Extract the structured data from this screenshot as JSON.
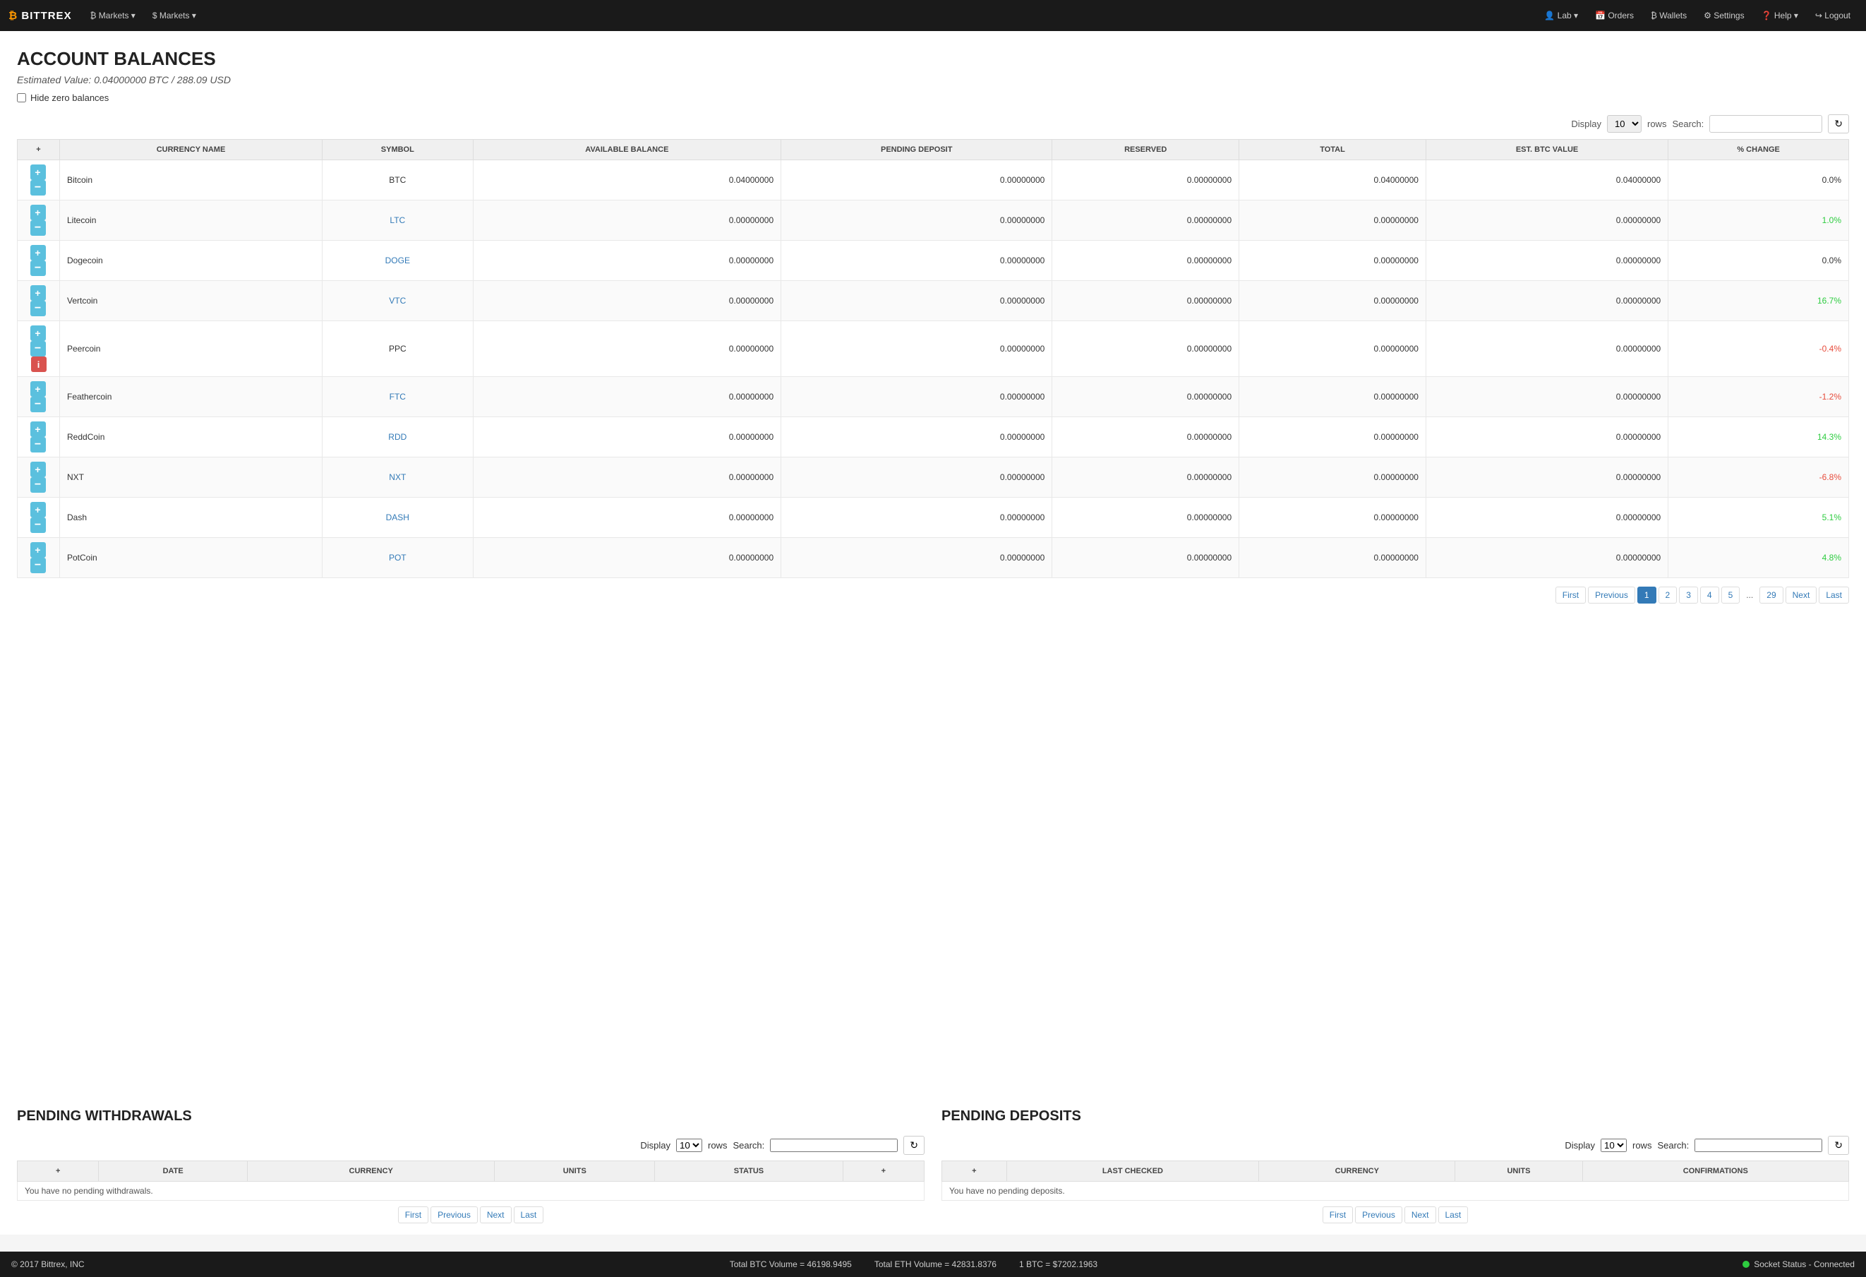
{
  "nav": {
    "logo": "BITTREX",
    "logo_icon": "₿",
    "menus_left": [
      {
        "label": "₿ Markets ▾",
        "id": "btc-markets"
      },
      {
        "label": "$ Markets ▾",
        "id": "usd-markets"
      }
    ],
    "menus_right": [
      {
        "label": "Lab ▾",
        "id": "lab"
      },
      {
        "label": "Orders",
        "id": "orders"
      },
      {
        "label": "Wallets",
        "id": "wallets"
      },
      {
        "label": "Settings",
        "id": "settings"
      },
      {
        "label": "Help ▾",
        "id": "help"
      },
      {
        "label": "Logout",
        "id": "logout"
      }
    ]
  },
  "page": {
    "title": "ACCOUNT BALANCES",
    "estimated_value": "Estimated Value: 0.04000000 BTC / 288.09 USD",
    "hide_zero_label": "Hide zero balances"
  },
  "balances_table": {
    "display_label": "Display",
    "display_value": "10",
    "rows_label": "rows",
    "search_label": "Search:",
    "search_placeholder": "",
    "columns": [
      "",
      "CURRENCY NAME",
      "SYMBOL",
      "AVAILABLE BALANCE",
      "PENDING DEPOSIT",
      "RESERVED",
      "TOTAL",
      "EST. BTC VALUE",
      "% CHANGE"
    ],
    "rows": [
      {
        "name": "Bitcoin",
        "symbol": "BTC",
        "symbol_link": false,
        "available": "0.04000000",
        "pending": "0.00000000",
        "reserved": "0.00000000",
        "total": "0.04000000",
        "btc_value": "0.04000000",
        "pct_change": "0.0%",
        "pct_class": "pct-zero",
        "has_info": false
      },
      {
        "name": "Litecoin",
        "symbol": "LTC",
        "symbol_link": true,
        "available": "0.00000000",
        "pending": "0.00000000",
        "reserved": "0.00000000",
        "total": "0.00000000",
        "btc_value": "0.00000000",
        "pct_change": "1.0%",
        "pct_class": "pct-positive",
        "has_info": false
      },
      {
        "name": "Dogecoin",
        "symbol": "DOGE",
        "symbol_link": true,
        "available": "0.00000000",
        "pending": "0.00000000",
        "reserved": "0.00000000",
        "total": "0.00000000",
        "btc_value": "0.00000000",
        "pct_change": "0.0%",
        "pct_class": "pct-zero",
        "has_info": false
      },
      {
        "name": "Vertcoin",
        "symbol": "VTC",
        "symbol_link": true,
        "available": "0.00000000",
        "pending": "0.00000000",
        "reserved": "0.00000000",
        "total": "0.00000000",
        "btc_value": "0.00000000",
        "pct_change": "16.7%",
        "pct_class": "pct-positive",
        "has_info": false
      },
      {
        "name": "Peercoin",
        "symbol": "PPC",
        "symbol_link": false,
        "available": "0.00000000",
        "pending": "0.00000000",
        "reserved": "0.00000000",
        "total": "0.00000000",
        "btc_value": "0.00000000",
        "pct_change": "-0.4%",
        "pct_class": "pct-negative",
        "has_info": true
      },
      {
        "name": "Feathercoin",
        "symbol": "FTC",
        "symbol_link": true,
        "available": "0.00000000",
        "pending": "0.00000000",
        "reserved": "0.00000000",
        "total": "0.00000000",
        "btc_value": "0.00000000",
        "pct_change": "-1.2%",
        "pct_class": "pct-negative",
        "has_info": false
      },
      {
        "name": "ReddCoin",
        "symbol": "RDD",
        "symbol_link": true,
        "available": "0.00000000",
        "pending": "0.00000000",
        "reserved": "0.00000000",
        "total": "0.00000000",
        "btc_value": "0.00000000",
        "pct_change": "14.3%",
        "pct_class": "pct-positive",
        "has_info": false
      },
      {
        "name": "NXT",
        "symbol": "NXT",
        "symbol_link": true,
        "available": "0.00000000",
        "pending": "0.00000000",
        "reserved": "0.00000000",
        "total": "0.00000000",
        "btc_value": "0.00000000",
        "pct_change": "-6.8%",
        "pct_class": "pct-negative",
        "has_info": false
      },
      {
        "name": "Dash",
        "symbol": "DASH",
        "symbol_link": true,
        "available": "0.00000000",
        "pending": "0.00000000",
        "reserved": "0.00000000",
        "total": "0.00000000",
        "btc_value": "0.00000000",
        "pct_change": "5.1%",
        "pct_class": "pct-positive",
        "has_info": false
      },
      {
        "name": "PotCoin",
        "symbol": "POT",
        "symbol_link": true,
        "available": "0.00000000",
        "pending": "0.00000000",
        "reserved": "0.00000000",
        "total": "0.00000000",
        "btc_value": "0.00000000",
        "pct_change": "4.8%",
        "pct_class": "pct-positive",
        "has_info": false
      }
    ],
    "pagination": {
      "first": "First",
      "prev": "Previous",
      "pages": [
        "1",
        "2",
        "3",
        "4",
        "5"
      ],
      "dots": "...",
      "last_page": "29",
      "next": "Next",
      "last": "Last",
      "active": "1"
    }
  },
  "pending_withdrawals": {
    "title": "PENDING WITHDRAWALS",
    "display_label": "Display",
    "display_value": "10",
    "rows_label": "rows",
    "search_label": "Search:",
    "search_placeholder": "",
    "columns": [
      "+",
      "DATE",
      "CURRENCY",
      "UNITS",
      "STATUS",
      "+"
    ],
    "empty_message": "You have no pending withdrawals.",
    "pagination": {
      "first": "First",
      "prev": "Previous",
      "next": "Next",
      "last": "Last"
    }
  },
  "pending_deposits": {
    "title": "PENDING DEPOSITS",
    "display_label": "Display",
    "display_value": "10",
    "rows_label": "rows",
    "search_label": "Search:",
    "search_placeholder": "",
    "columns": [
      "+",
      "LAST CHECKED",
      "CURRENCY",
      "UNITS",
      "CONFIRMATIONS"
    ],
    "empty_message": "You have no pending deposits.",
    "pagination": {
      "first": "First",
      "prev": "Previous",
      "next": "Next",
      "last": "Last"
    }
  },
  "footer": {
    "copyright": "© 2017 Bittrex, INC",
    "btc_volume": "Total BTC Volume = 46198.9495",
    "eth_volume": "Total ETH Volume = 42831.8376",
    "btc_price": "1 BTC = $7202.1963",
    "socket_status": "Socket Status - Connected"
  }
}
